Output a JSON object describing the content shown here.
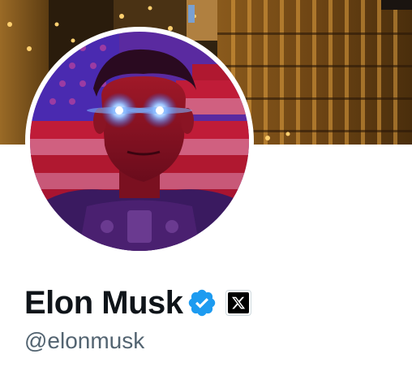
{
  "profile": {
    "display_name": "Elon Musk",
    "handle": "@elonmusk",
    "verified": true,
    "verified_icon": "verified-badge-icon",
    "affiliate_icon": "x-logo-icon"
  },
  "colors": {
    "verified_blue": "#1d9bf0",
    "name_text": "#0f1419",
    "handle_text": "#536471",
    "avatar_tint": "#c0182a"
  }
}
